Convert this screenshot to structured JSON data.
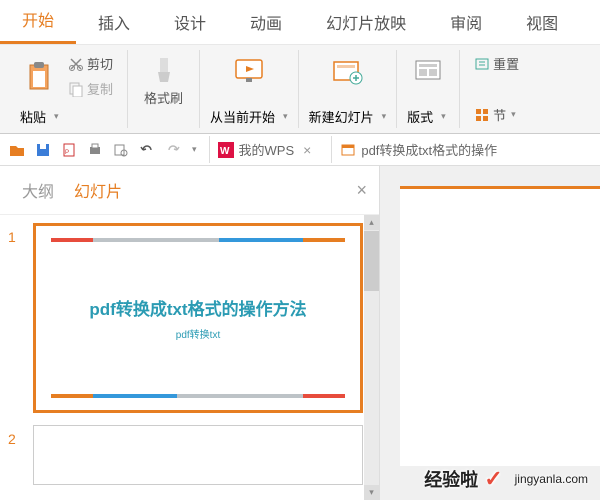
{
  "tabs": {
    "start": "开始",
    "insert": "插入",
    "design": "设计",
    "animation": "动画",
    "slideshow": "幻灯片放映",
    "review": "审阅",
    "view": "视图"
  },
  "ribbon": {
    "cut": "剪切",
    "paste": "粘贴",
    "copy": "复制",
    "format_painter": "格式刷",
    "from_current": "从当前开始",
    "new_slide": "新建幻灯片",
    "layout": "版式",
    "reset": "重置",
    "section": "节"
  },
  "doc_tabs": {
    "my_wps": "我的WPS",
    "current_doc": "pdf转换成txt格式的操作"
  },
  "sidebar": {
    "outline": "大纲",
    "slides": "幻灯片"
  },
  "slides": [
    {
      "num": "1",
      "title": "pdf转换成txt格式的操作方法",
      "subtitle": "pdf转换txt"
    },
    {
      "num": "2",
      "title": "",
      "subtitle": ""
    }
  ],
  "watermark": {
    "text": "经验啦",
    "url": "jingyanla.com"
  }
}
